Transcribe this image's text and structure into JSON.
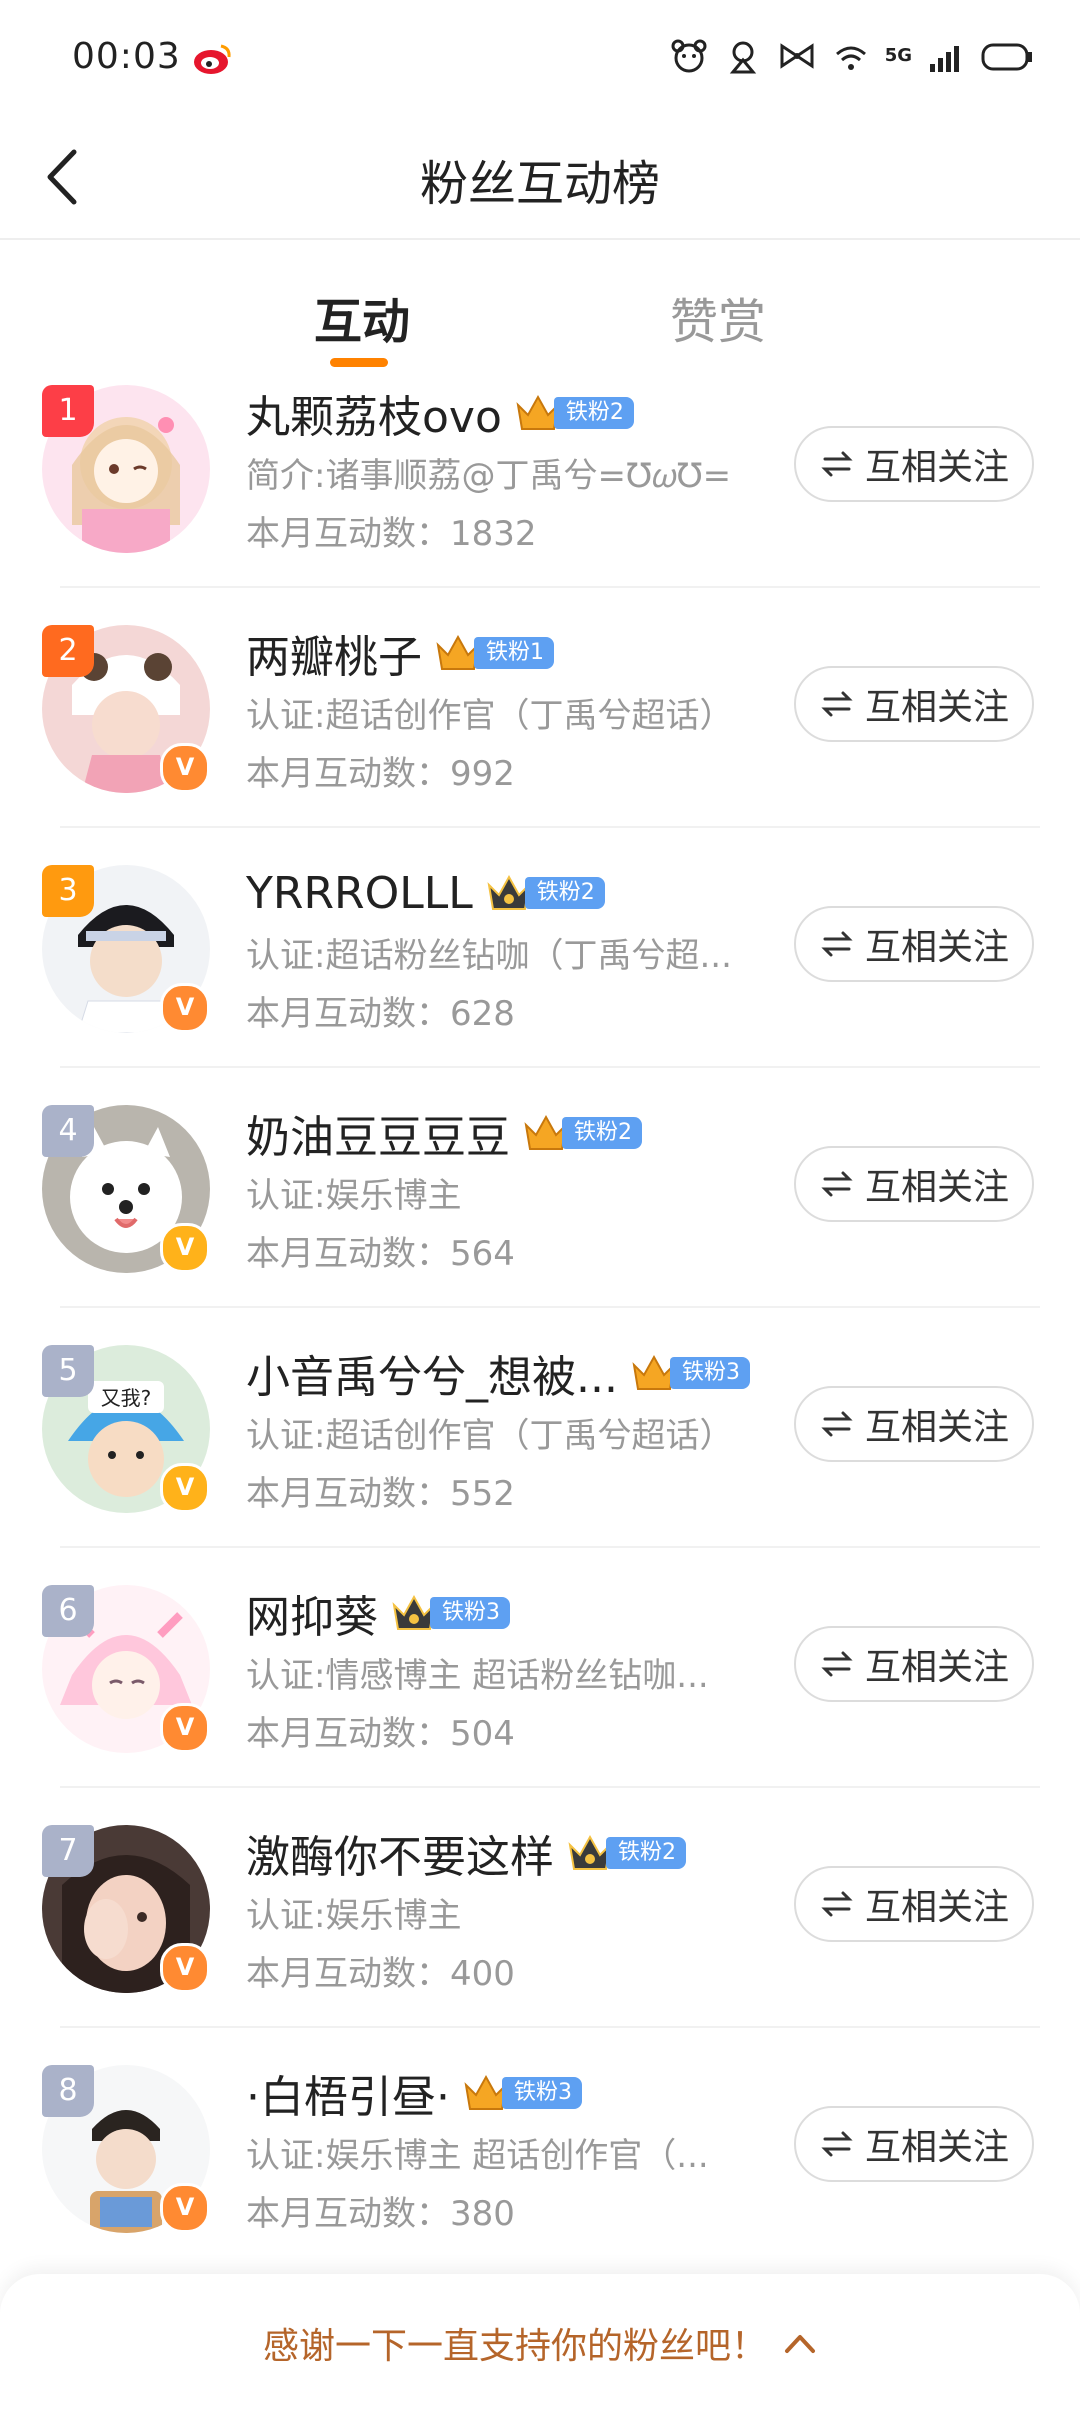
{
  "status_bar": {
    "time": "00:03",
    "network": "5G"
  },
  "header": {
    "title": "粉丝互动榜"
  },
  "tabs": [
    {
      "label": "互动"
    },
    {
      "label": "赞赏"
    }
  ],
  "colors": {
    "accent": "#ff8200",
    "rank_1": "#fd3e47",
    "rank_2": "#ff6a1f",
    "rank_3": "#ff9a0f",
    "rank_other": "#aab2c9",
    "verify_orange": "#ff8a32",
    "verify_yellow": "#ffb21a",
    "badge_blue": "#5ea0f2"
  },
  "fans": [
    {
      "rank": "1",
      "name": "丸颗荔枝ovo",
      "badge": "铁粉2",
      "desc": "简介:诸事顺荔@丁禹兮=Ʊ𝜔Ʊ=",
      "count": "本月互动数：1832",
      "follow": "互相关注",
      "verify": ""
    },
    {
      "rank": "2",
      "name": "两瓣桃子",
      "badge": "铁粉1",
      "desc": "认证:超话创作官（丁禹兮超话）",
      "count": "本月互动数：992",
      "follow": "互相关注",
      "verify": "V"
    },
    {
      "rank": "3",
      "name": "YRRROLLL",
      "badge": "铁粉2",
      "desc": "认证:超话粉丝钻咖（丁禹兮超...",
      "count": "本月互动数：628",
      "follow": "互相关注",
      "verify": "V"
    },
    {
      "rank": "4",
      "name": "奶油豆豆豆豆",
      "badge": "铁粉2",
      "desc": "认证:娱乐博主",
      "count": "本月互动数：564",
      "follow": "互相关注",
      "verify": "V"
    },
    {
      "rank": "5",
      "name": "小音禹兮兮_想被...",
      "badge": "铁粉3",
      "desc": "认证:超话创作官（丁禹兮超话）",
      "count": "本月互动数：552",
      "follow": "互相关注",
      "verify": "V",
      "avatar_text": "又我?"
    },
    {
      "rank": "6",
      "name": "网抑葵",
      "badge": "铁粉3",
      "desc": "认证:情感博主 超话粉丝钻咖...",
      "count": "本月互动数：504",
      "follow": "互相关注",
      "verify": "V"
    },
    {
      "rank": "7",
      "name": "激酶你不要这样",
      "badge": "铁粉2",
      "desc": "认证:娱乐博主",
      "count": "本月互动数：400",
      "follow": "互相关注",
      "verify": "V"
    },
    {
      "rank": "8",
      "name": "·白梧引昼·",
      "badge": "铁粉3",
      "desc": "认证:娱乐博主 超话创作官（...",
      "count": "本月互动数：380",
      "follow": "互相关注",
      "verify": "V"
    }
  ],
  "bottom_bar": {
    "text": "感谢一下一直支持你的粉丝吧！"
  }
}
